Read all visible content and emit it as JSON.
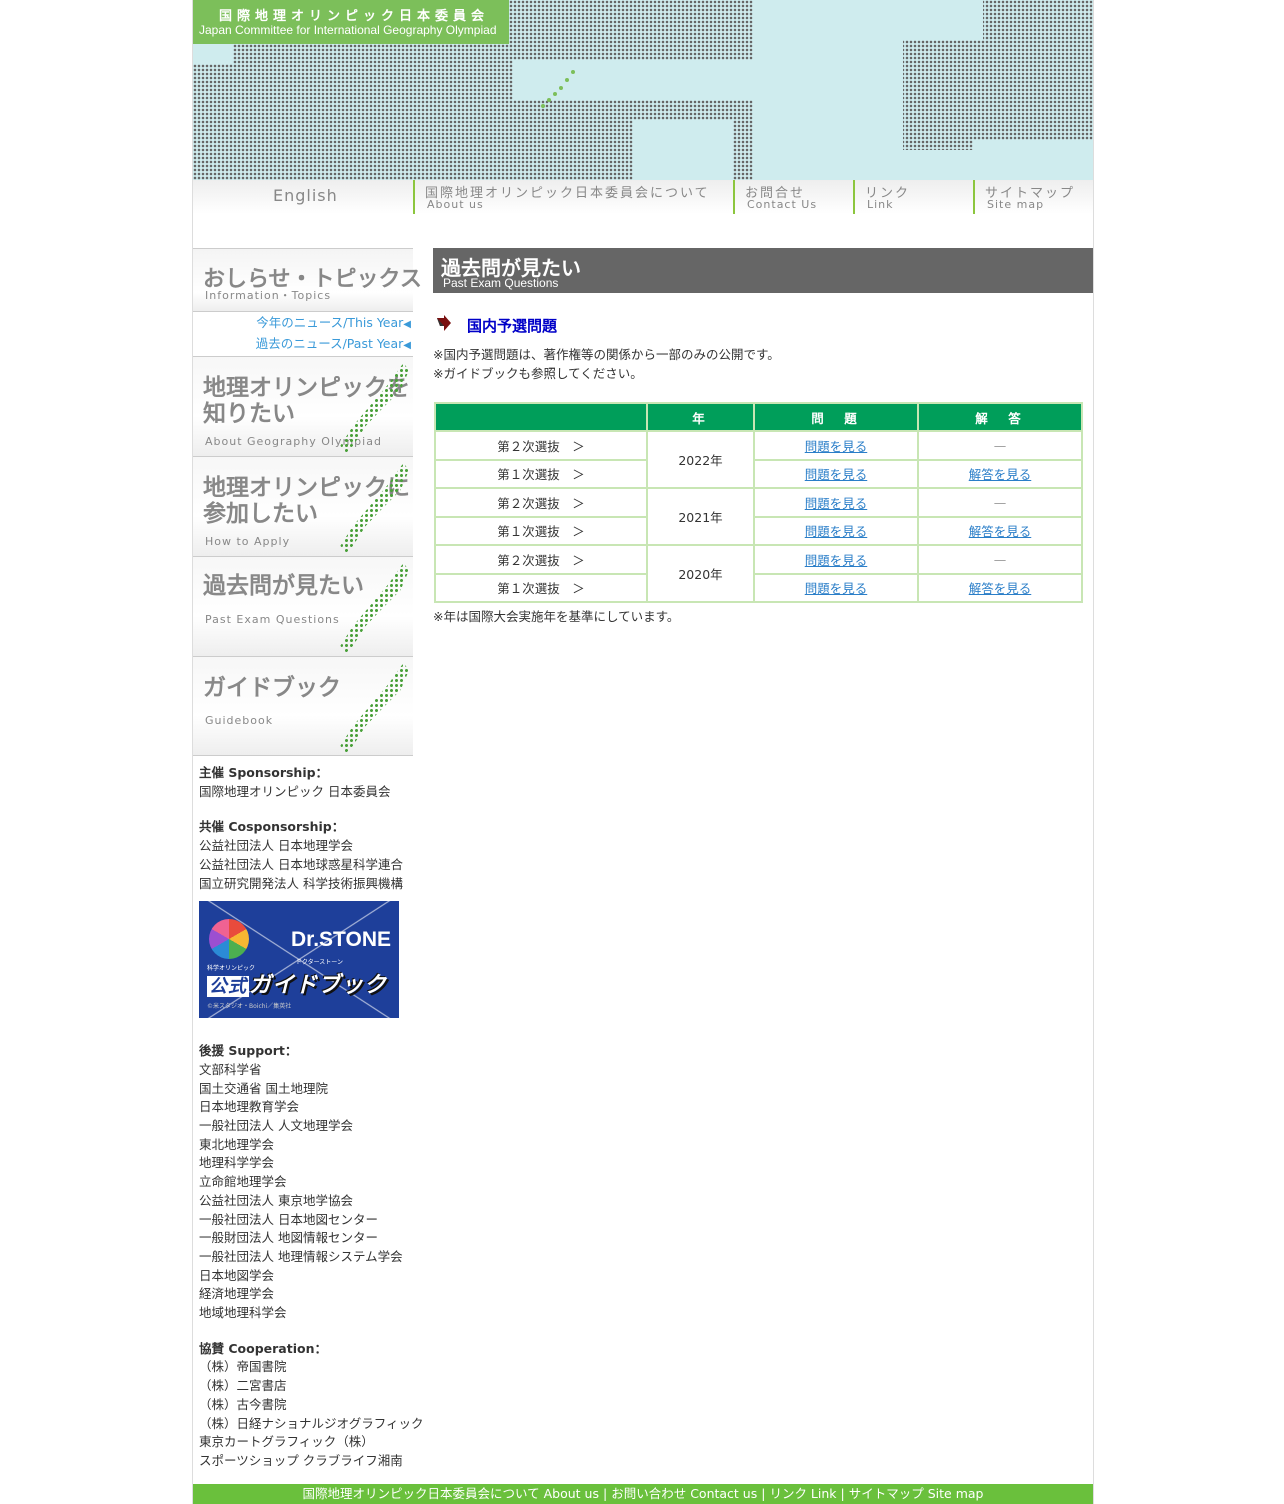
{
  "header": {
    "logo_jp": "国際地理オリンピック日本委員会",
    "logo_en": "Japan Committee for International Geography Olympiad"
  },
  "nav": {
    "english": "English",
    "items": [
      {
        "jp": "国際地理オリンピック日本委員会について",
        "en": "About us"
      },
      {
        "jp": "お問合せ",
        "en": "Contact Us"
      },
      {
        "jp": "リンク",
        "en": "Link"
      },
      {
        "jp": "サイトマップ",
        "en": "Site map"
      }
    ]
  },
  "sidebar": {
    "topics": {
      "title": "おしらせ・トピックス",
      "sub": "Information・Topics"
    },
    "news_links": [
      "今年のニュース/This Year",
      "過去のニュース/Past Year"
    ],
    "news_marker": "◀",
    "blocks": [
      {
        "line1": "地理オリンピックを",
        "line2": "知りたい",
        "sub": "About Geography Olympiad"
      },
      {
        "line1": "地理オリンピックに",
        "line2": "参加したい",
        "sub": "How to Apply"
      },
      {
        "line1": "過去問が見たい",
        "line2": "",
        "sub": "Past Exam Questions"
      },
      {
        "line1": "ガイドブック",
        "line2": "",
        "sub": "Guidebook"
      }
    ],
    "sponsorship_head": "主催 Sponsorship：",
    "sponsorship": [
      "国際地理オリンピック 日本委員会"
    ],
    "cosponsorship_head": "共催 Cosponsorship：",
    "cosponsorship": [
      "公益社団法人 日本地理学会",
      "公益社団法人 日本地球惑星科学連合",
      "国立研究開発法人 科学技術振興機構"
    ],
    "banner": {
      "flower_caption": "科学オリンピック",
      "title": "Dr.STONE",
      "title_sub": "ドクターストーン",
      "guide_badge": "公式",
      "guide": "ガイドブック",
      "copy": "©米スタジオ・Boichi／集英社"
    },
    "support_head": "後援 Support：",
    "support": [
      "文部科学省",
      "国土交通省 国土地理院",
      "日本地理教育学会",
      "一般社団法人 人文地理学会",
      "東北地理学会",
      "地理科学学会",
      "立命館地理学会",
      "公益社団法人 東京地学協会",
      "一般社団法人 日本地図センター",
      "一般財団法人 地図情報センター",
      "一般社団法人 地理情報システム学会",
      "日本地図学会",
      "経済地理学会",
      "地域地理科学会"
    ],
    "cooperation_head": "協賛 Cooperation：",
    "cooperation": [
      "（株）帝国書院",
      "（株）二宮書店",
      "（株）古今書院",
      "（株）日経ナショナルジオグラフィック",
      "東京カートグラフィック（株）",
      "スポーツショップ クラブライフ湘南"
    ]
  },
  "main": {
    "page_title_jp": "過去問が見たい",
    "page_title_en": "Past Exam Questions",
    "section_title": "国内予選問題",
    "notes": [
      "※国内予選問題は、著作権等の関係から一部のみの公開です。",
      "※ガイドブックも参照してください。"
    ],
    "table": {
      "headers": [
        "",
        "年",
        "問　題",
        "解　答"
      ],
      "groups": [
        {
          "year": "2022年",
          "rows": [
            {
              "round": "第２次選抜　＞",
              "question": "問題を見る",
              "answer": "—",
              "answer_link": false
            },
            {
              "round": "第１次選抜　＞",
              "question": "問題を見る",
              "answer": "解答を見る",
              "answer_link": true
            }
          ]
        },
        {
          "year": "2021年",
          "rows": [
            {
              "round": "第２次選抜　＞",
              "question": "問題を見る",
              "answer": "—",
              "answer_link": false
            },
            {
              "round": "第１次選抜　＞",
              "question": "問題を見る",
              "answer": "解答を見る",
              "answer_link": true
            }
          ]
        },
        {
          "year": "2020年",
          "rows": [
            {
              "round": "第２次選抜　＞",
              "question": "問題を見る",
              "answer": "—",
              "answer_link": false
            },
            {
              "round": "第１次選抜　＞",
              "question": "問題を見る",
              "answer": "解答を見る",
              "answer_link": true
            }
          ]
        }
      ]
    },
    "table_note": "※年は国際大会実施年を基準にしています。"
  },
  "footer": {
    "links": [
      "国際地理オリンピック日本委員会について  About us",
      "お問い合わせ  Contact us",
      "リンク  Link",
      "サイトマップ  Site map"
    ],
    "separator": "|"
  },
  "colors": {
    "brand_green": "#7cbf5a",
    "table_header": "#009e5a",
    "footer_green": "#6ac03c",
    "link_blue": "#2a7ec8",
    "section_blue": "#0000c8",
    "page_head_gray": "#666666"
  }
}
